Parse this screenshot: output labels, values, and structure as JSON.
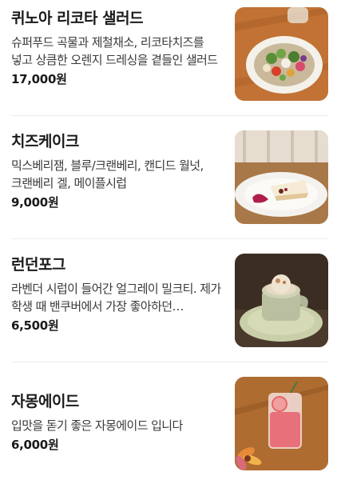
{
  "menu": {
    "items": [
      {
        "name": "퀴노아 리코타 샐러드",
        "description": "슈퍼푸드 곡물과 제철채소, 리코타치즈를 넣고 상큼한 오렌지 드레싱을 곁들인 샐러드",
        "price": "17,000원",
        "image": "quinoa-ricotta-salad-photo"
      },
      {
        "name": "치즈케이크",
        "description": "믹스베리잼, 블루/크랜베리, 캔디드 월넛, 크랜베리 겔, 메이플시럽",
        "price": "9,000원",
        "image": "cheesecake-photo"
      },
      {
        "name": "런던포그",
        "description": "라벤더 시럽이 들어간 얼그레이 밀크티. 제가 학생 때 밴쿠버에서 가장 좋아하던 음료입니다",
        "price": "6,500원",
        "image": "london-fog-photo"
      },
      {
        "name": "자몽에이드",
        "description": "입맛을 돋기 좋은 자몽에이드 입니다",
        "price": "6,000원",
        "image": "grapefruit-ade-photo"
      }
    ]
  }
}
